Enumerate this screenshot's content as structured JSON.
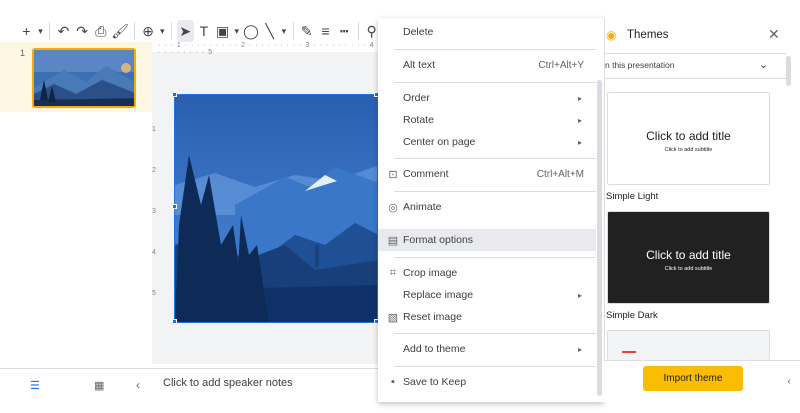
{
  "toolbar": {
    "items": [
      {
        "name": "new-slide-icon",
        "glyph": "+"
      },
      {
        "name": "new-slide-dropdown-icon",
        "glyph": "▾"
      },
      {
        "name": "undo-icon",
        "glyph": "↶"
      },
      {
        "name": "redo-icon",
        "glyph": "↷"
      },
      {
        "name": "print-icon",
        "glyph": "⎙"
      },
      {
        "name": "paint-format-icon",
        "glyph": "🖌"
      },
      {
        "name": "zoom-icon",
        "glyph": "⊕"
      },
      {
        "name": "zoom-dropdown-icon",
        "glyph": "▾"
      },
      {
        "name": "select-icon",
        "glyph": "➤"
      },
      {
        "name": "text-box-icon",
        "glyph": "T"
      },
      {
        "name": "image-icon",
        "glyph": "▣"
      },
      {
        "name": "image-dropdown-icon",
        "glyph": "▾"
      },
      {
        "name": "shape-icon",
        "glyph": "◯"
      },
      {
        "name": "line-icon",
        "glyph": "╲"
      },
      {
        "name": "line-dropdown-icon",
        "glyph": "▾"
      },
      {
        "name": "pen-icon",
        "glyph": "✎"
      },
      {
        "name": "border-weight-icon",
        "glyph": "≡"
      },
      {
        "name": "border-dash-icon",
        "glyph": "┅"
      },
      {
        "name": "link-icon",
        "glyph": "⚲"
      }
    ]
  },
  "filmstrip": {
    "slide_number": "1"
  },
  "ruler": {
    "horizontal": "· · · 1 · · · · · · · · · 2 · · · · · · · · · 3 · · · · · · · · · 4 · · · · · · · · 5",
    "vertical": [
      "1",
      "2",
      "3",
      "4",
      "5"
    ]
  },
  "notes": {
    "placeholder": "Click to add speaker notes"
  },
  "context_menu": {
    "items": [
      {
        "name": "menu-delete",
        "label": "Delete",
        "icon": "",
        "shortcut": "",
        "arrow": false
      },
      {
        "name": "menu-alt-text",
        "label": "Alt text",
        "icon": "",
        "shortcut": "Ctrl+Alt+Y",
        "arrow": false
      },
      {
        "name": "menu-order",
        "label": "Order",
        "icon": "",
        "shortcut": "",
        "arrow": true
      },
      {
        "name": "menu-rotate",
        "label": "Rotate",
        "icon": "",
        "shortcut": "",
        "arrow": true
      },
      {
        "name": "menu-center-on-page",
        "label": "Center on page",
        "icon": "",
        "shortcut": "",
        "arrow": true
      },
      {
        "name": "menu-comment",
        "label": "Comment",
        "icon": "⊡",
        "shortcut": "Ctrl+Alt+M",
        "arrow": false
      },
      {
        "name": "menu-animate",
        "label": "Animate",
        "icon": "◎",
        "shortcut": "",
        "arrow": false
      },
      {
        "name": "menu-format-options",
        "label": "Format options",
        "icon": "▤",
        "shortcut": "",
        "arrow": false
      },
      {
        "name": "menu-crop-image",
        "label": "Crop image",
        "icon": "⌗",
        "shortcut": "",
        "arrow": false
      },
      {
        "name": "menu-replace-image",
        "label": "Replace image",
        "icon": "",
        "shortcut": "",
        "arrow": true
      },
      {
        "name": "menu-reset-image",
        "label": "Reset image",
        "icon": "▧",
        "shortcut": "",
        "arrow": false
      },
      {
        "name": "menu-add-to-theme",
        "label": "Add to theme",
        "icon": "",
        "shortcut": "",
        "arrow": true
      },
      {
        "name": "menu-save-to-keep",
        "label": "Save to Keep",
        "icon": "▪",
        "shortcut": "",
        "arrow": false
      }
    ],
    "arrow_glyph": "▸"
  },
  "themes": {
    "title": "Themes",
    "close_glyph": "✕",
    "section_label": "n this presentation",
    "chevron_glyph": "⌄",
    "cards": [
      {
        "name": "Simple Light",
        "title": "Click to add title",
        "subtitle": "Click to add subtitle",
        "bg": "#ffffff",
        "fg": "#202124"
      },
      {
        "name": "Simple Dark",
        "title": "Click to add title",
        "subtitle": "Click to add subtitle",
        "bg": "#212121",
        "fg": "#ffffff"
      }
    ],
    "import_label": "Import theme"
  },
  "colors": {
    "accent": "#1a73e8",
    "import_button": "#fbbc04",
    "selected_slide_border": "#f9ab00",
    "sky": "#2b63b7"
  }
}
